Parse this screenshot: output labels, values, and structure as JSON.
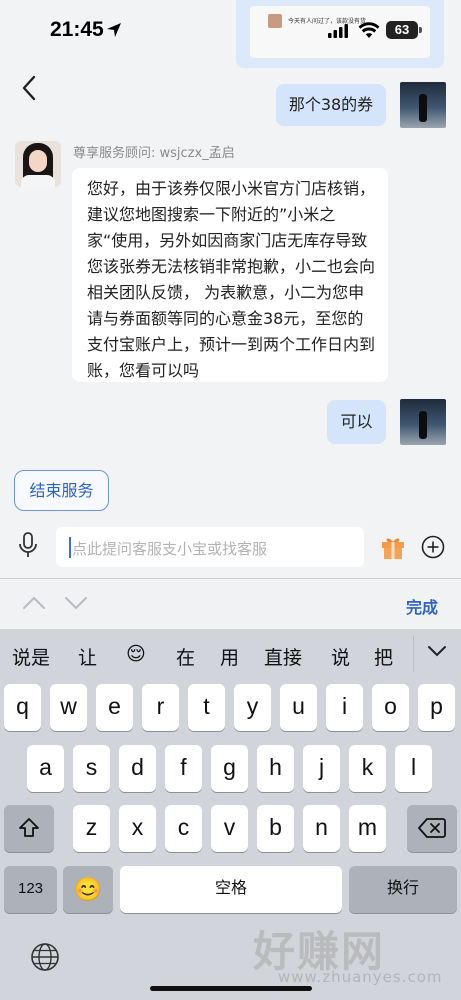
{
  "status": {
    "time": "21:45",
    "battery": "63"
  },
  "thumbnail": {
    "text": "今天有人问过了，该款没有货"
  },
  "chat": {
    "user_msg_1": "那个38的券",
    "agent_name": "尊享服务顾问: wsjczx_孟启",
    "agent_msg": "您好，由于该券仅限小米官方门店核销，建议您地图搜索一下附近的”小米之家“使用，另外如因商家门店无库存导致您该张券无法核销非常抱歉，小二也会向相关团队反馈， 为表歉意，小二为您申请与券面额等同的心意金38元，至您的支付宝账户上，预计一到两个工作日内到账，您看可以吗",
    "user_msg_2": "可以"
  },
  "end_service_label": "结束服务",
  "input": {
    "placeholder": "点此提问客服支小宝或找客服"
  },
  "keyboard": {
    "done_label": "完成",
    "candidates": [
      "说是",
      "让",
      "😌",
      "在",
      "用",
      "直接",
      "说",
      "把"
    ],
    "row1": [
      "q",
      "w",
      "e",
      "r",
      "t",
      "y",
      "u",
      "i",
      "o",
      "p"
    ],
    "row2": [
      "a",
      "s",
      "d",
      "f",
      "g",
      "h",
      "j",
      "k",
      "l"
    ],
    "row3": [
      "z",
      "x",
      "c",
      "v",
      "b",
      "n",
      "m"
    ],
    "num_label": "123",
    "emoji_label": "😊",
    "space_label": "空格",
    "return_label": "换行"
  },
  "watermark": {
    "logo": "好赚网",
    "url": "www.zhuanyes.com"
  },
  "colors": {
    "accent": "#2f64bd",
    "user_bubble": "#d4e5fb"
  },
  "icons": [
    "back-icon",
    "location-arrow-icon",
    "signal-icon",
    "wifi-icon",
    "microphone-icon",
    "gift-icon",
    "plus-circle-icon",
    "shift-icon",
    "delete-icon",
    "globe-icon",
    "chevron-up-icon",
    "chevron-down-icon"
  ]
}
